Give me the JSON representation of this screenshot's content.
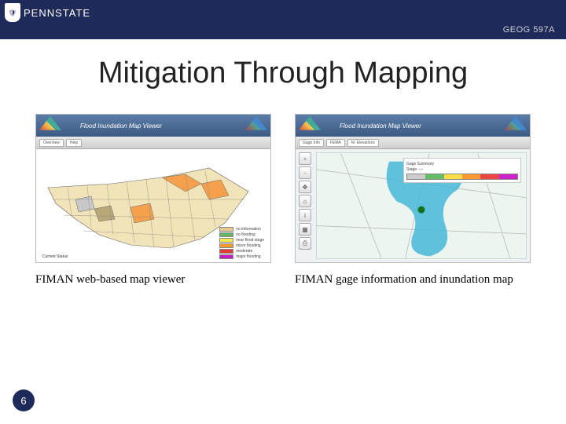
{
  "header": {
    "logo_text": "PENNSTATE",
    "course_code": "GEOG 597A"
  },
  "title": "Mitigation Through Mapping",
  "figures": {
    "left": {
      "mini_title": "Flood Inundation Map Viewer",
      "caption": "FIMAN web-based map  viewer",
      "legend_text": "Current Status",
      "swatches": [
        {
          "color": "#e7c98a",
          "label": "no information"
        },
        {
          "color": "#66b266",
          "label": "no flooding"
        },
        {
          "color": "#ffe84d",
          "label": "near flood stage"
        },
        {
          "color": "#ff9a33",
          "label": "minor flooding"
        },
        {
          "color": "#e33838",
          "label": "moderate"
        },
        {
          "color": "#c21fc2",
          "label": "major flooding"
        }
      ]
    },
    "right": {
      "mini_title": "Flood Inundation Map Viewer",
      "caption": "FIMAN gage information and inundation map",
      "info_title": "Gage Summary",
      "gage_segments": [
        "#ccc",
        "#6b6",
        "#fd4",
        "#f93",
        "#e44",
        "#c2c"
      ]
    }
  },
  "slide_number": "6"
}
